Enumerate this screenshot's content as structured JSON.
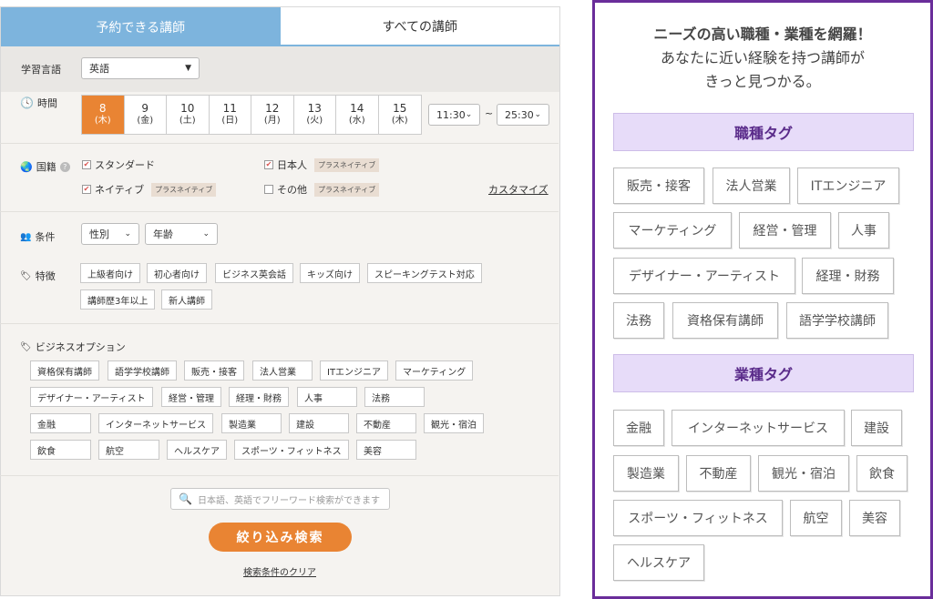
{
  "tabs": {
    "available": "予約できる講師",
    "all": "すべての講師"
  },
  "language": {
    "label": "学習言語",
    "value": "英語"
  },
  "time": {
    "label": "時間",
    "dates": [
      {
        "day": "8",
        "weekday": "(木)",
        "selected": true
      },
      {
        "day": "9",
        "weekday": "(金)",
        "selected": false
      },
      {
        "day": "10",
        "weekday": "(土)",
        "selected": false
      },
      {
        "day": "11",
        "weekday": "(日)",
        "selected": false
      },
      {
        "day": "12",
        "weekday": "(月)",
        "selected": false
      },
      {
        "day": "13",
        "weekday": "(火)",
        "selected": false
      },
      {
        "day": "14",
        "weekday": "(水)",
        "selected": false
      },
      {
        "day": "15",
        "weekday": "(木)",
        "selected": false
      }
    ],
    "from": "11:30",
    "separator": "~",
    "to": "25:30"
  },
  "nationality": {
    "label": "国籍",
    "options": [
      {
        "label": "スタンダード",
        "checked": true,
        "badge": ""
      },
      {
        "label": "日本人",
        "checked": true,
        "badge": "プラスネイティブ"
      },
      {
        "label": "ネイティブ",
        "checked": true,
        "badge": "プラスネイティブ"
      },
      {
        "label": "その他",
        "checked": false,
        "badge": "プラスネイティブ"
      }
    ],
    "customize": "カスタマイズ"
  },
  "conditions": {
    "label": "条件",
    "gender": "性別",
    "age": "年齢"
  },
  "features": {
    "label": "特徴",
    "tags": [
      "上級者向け",
      "初心者向け",
      "ビジネス英会話",
      "キッズ向け",
      "スピーキングテスト対応",
      "講師歴3年以上",
      "新人講師"
    ]
  },
  "business": {
    "label": "ビジネスオプション",
    "tags": [
      "資格保有講師",
      "語学学校講師",
      "販売・接客",
      "法人営業",
      "ITエンジニア",
      "マーケティング",
      "デザイナー・アーティスト",
      "経営・管理",
      "経理・財務",
      "人事",
      "法務",
      "金融",
      "インターネットサービス",
      "製造業",
      "建設",
      "不動産",
      "観光・宿泊",
      "飲食",
      "航空",
      "ヘルスケア",
      "スポーツ・フィットネス",
      "美容"
    ]
  },
  "search": {
    "placeholder": "日本語、英語でフリーワード検索ができます"
  },
  "actions": {
    "submit": "絞り込み検索",
    "clear": "検索条件のクリア"
  },
  "promo": {
    "line1": "ニーズの高い職種・業種を網羅！",
    "line2": "あなたに近い経験を持つ講師が",
    "line3": "きっと見つかる。",
    "job_header": "職種タグ",
    "job_tags": [
      "販売・接客",
      "法人営業",
      "ITエンジニア",
      "マーケティング",
      "経営・管理",
      "人事",
      "デザイナー・アーティスト",
      "経理・財務",
      "法務",
      "資格保有講師",
      "語学学校講師"
    ],
    "industry_header": "業種タグ",
    "industry_tags": [
      "金融",
      "インターネットサービス",
      "建設",
      "製造業",
      "不動産",
      "観光・宿泊",
      "飲食",
      "スポーツ・フィットネス",
      "航空",
      "美容",
      "ヘルスケア"
    ]
  },
  "colors": {
    "tab_active": "#7db4dd",
    "accent_orange": "#e98433",
    "purple_border": "#6a2d9a",
    "tag_header_bg": "#e7dcf9"
  }
}
